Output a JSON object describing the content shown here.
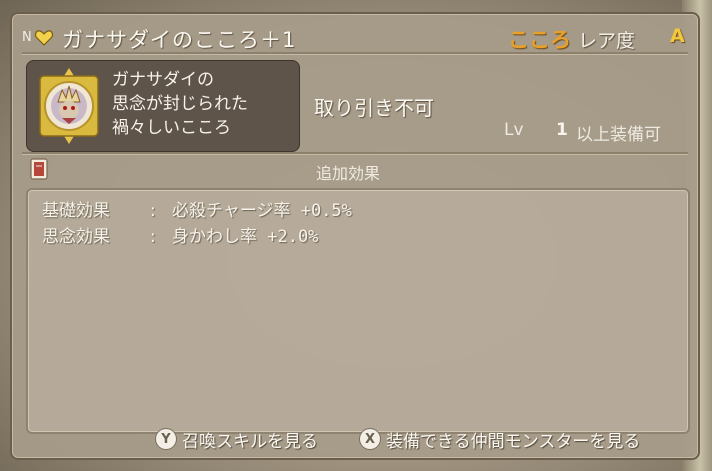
{
  "header": {
    "n_mark": "N",
    "title": "ガナサダイのこころ＋1",
    "kokoro_label": "こころ",
    "rarity_label": "レア度",
    "rarity_value": "A"
  },
  "card": {
    "line1": "ガナサダイの",
    "line2": "思念が封じられた",
    "line3": "禍々しいこころ"
  },
  "info": {
    "trade": "取り引き不可",
    "lv_label": "Lv",
    "lv_value": "1",
    "lv_suffix": "以上装備可"
  },
  "extra": {
    "header": "追加効果",
    "rows": [
      {
        "label": "基礎効果",
        "colon": ":",
        "value": "必殺チャージ率 +0.5%"
      },
      {
        "label": "思念効果",
        "colon": ":",
        "value": "身かわし率 +2.0%"
      }
    ]
  },
  "footer": {
    "y_button": "Y",
    "y_label": "召喚スキルを見る",
    "x_button": "X",
    "x_label": "装備できる仲間モンスターを見る"
  },
  "colors": {
    "kokoro": "#e8a02a",
    "rarity": "#f2c73a",
    "card_bg": "#5f544a"
  },
  "icons": [
    "heart-icon",
    "medal-icon",
    "book-icon"
  ]
}
